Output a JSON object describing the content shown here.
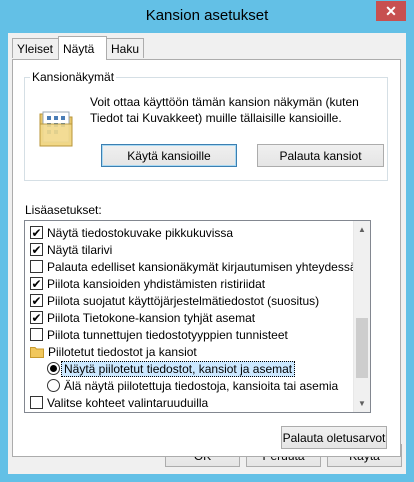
{
  "window": {
    "title": "Kansion asetukset",
    "close_glyph": "✕"
  },
  "tabs": [
    {
      "label": "Yleiset"
    },
    {
      "label": "Näytä"
    },
    {
      "label": "Haku"
    }
  ],
  "folder_views": {
    "group_label": "Kansionäkymät",
    "description_line1": "Voit ottaa käyttöön tämän kansion näkymän (kuten",
    "description_line2": "Tiedot tai Kuvakkeet) muille tällaisille kansioille.",
    "apply_button": "Käytä kansioille",
    "reset_button": "Palauta kansiot"
  },
  "advanced": {
    "label": "Lisäasetukset:",
    "items": [
      {
        "label": "Näytä tiedostokuvake pikkukuvissa",
        "type": "checkbox",
        "checked": true
      },
      {
        "label": "Näytä tilarivi",
        "type": "checkbox",
        "checked": true
      },
      {
        "label": "Palauta edelliset kansionäkymät kirjautumisen yhteydessä",
        "type": "checkbox",
        "checked": false
      },
      {
        "label": "Piilota kansioiden yhdistämisten ristiriidat",
        "type": "checkbox",
        "checked": true
      },
      {
        "label": "Piilota suojatut käyttöjärjestelmätiedostot (suositus)",
        "type": "checkbox",
        "checked": true
      },
      {
        "label": "Piilota Tietokone-kansion tyhjät asemat",
        "type": "checkbox",
        "checked": true
      },
      {
        "label": "Piilota tunnettujen tiedostotyyppien tunnisteet",
        "type": "checkbox",
        "checked": false
      },
      {
        "label": "Piilotetut tiedostot ja kansiot",
        "type": "folder"
      },
      {
        "label": "Näytä piilotetut tiedostot, kansiot ja asemat",
        "type": "radio",
        "checked": true
      },
      {
        "label": "Älä näytä piilotettuja tiedostoja, kansioita tai asemia",
        "type": "radio",
        "checked": false
      },
      {
        "label": "Valitse kohteet valintaruuduilla",
        "type": "checkbox",
        "checked": false
      }
    ],
    "check_glyph": "✔",
    "restore_defaults_button": "Palauta oletusarvot"
  },
  "footer": {
    "ok": "OK",
    "cancel": "Peruuta",
    "apply": "Käytä"
  },
  "colors": {
    "frame": "#63c0e6",
    "selection": "#cce8ff",
    "close": "#c75050"
  }
}
